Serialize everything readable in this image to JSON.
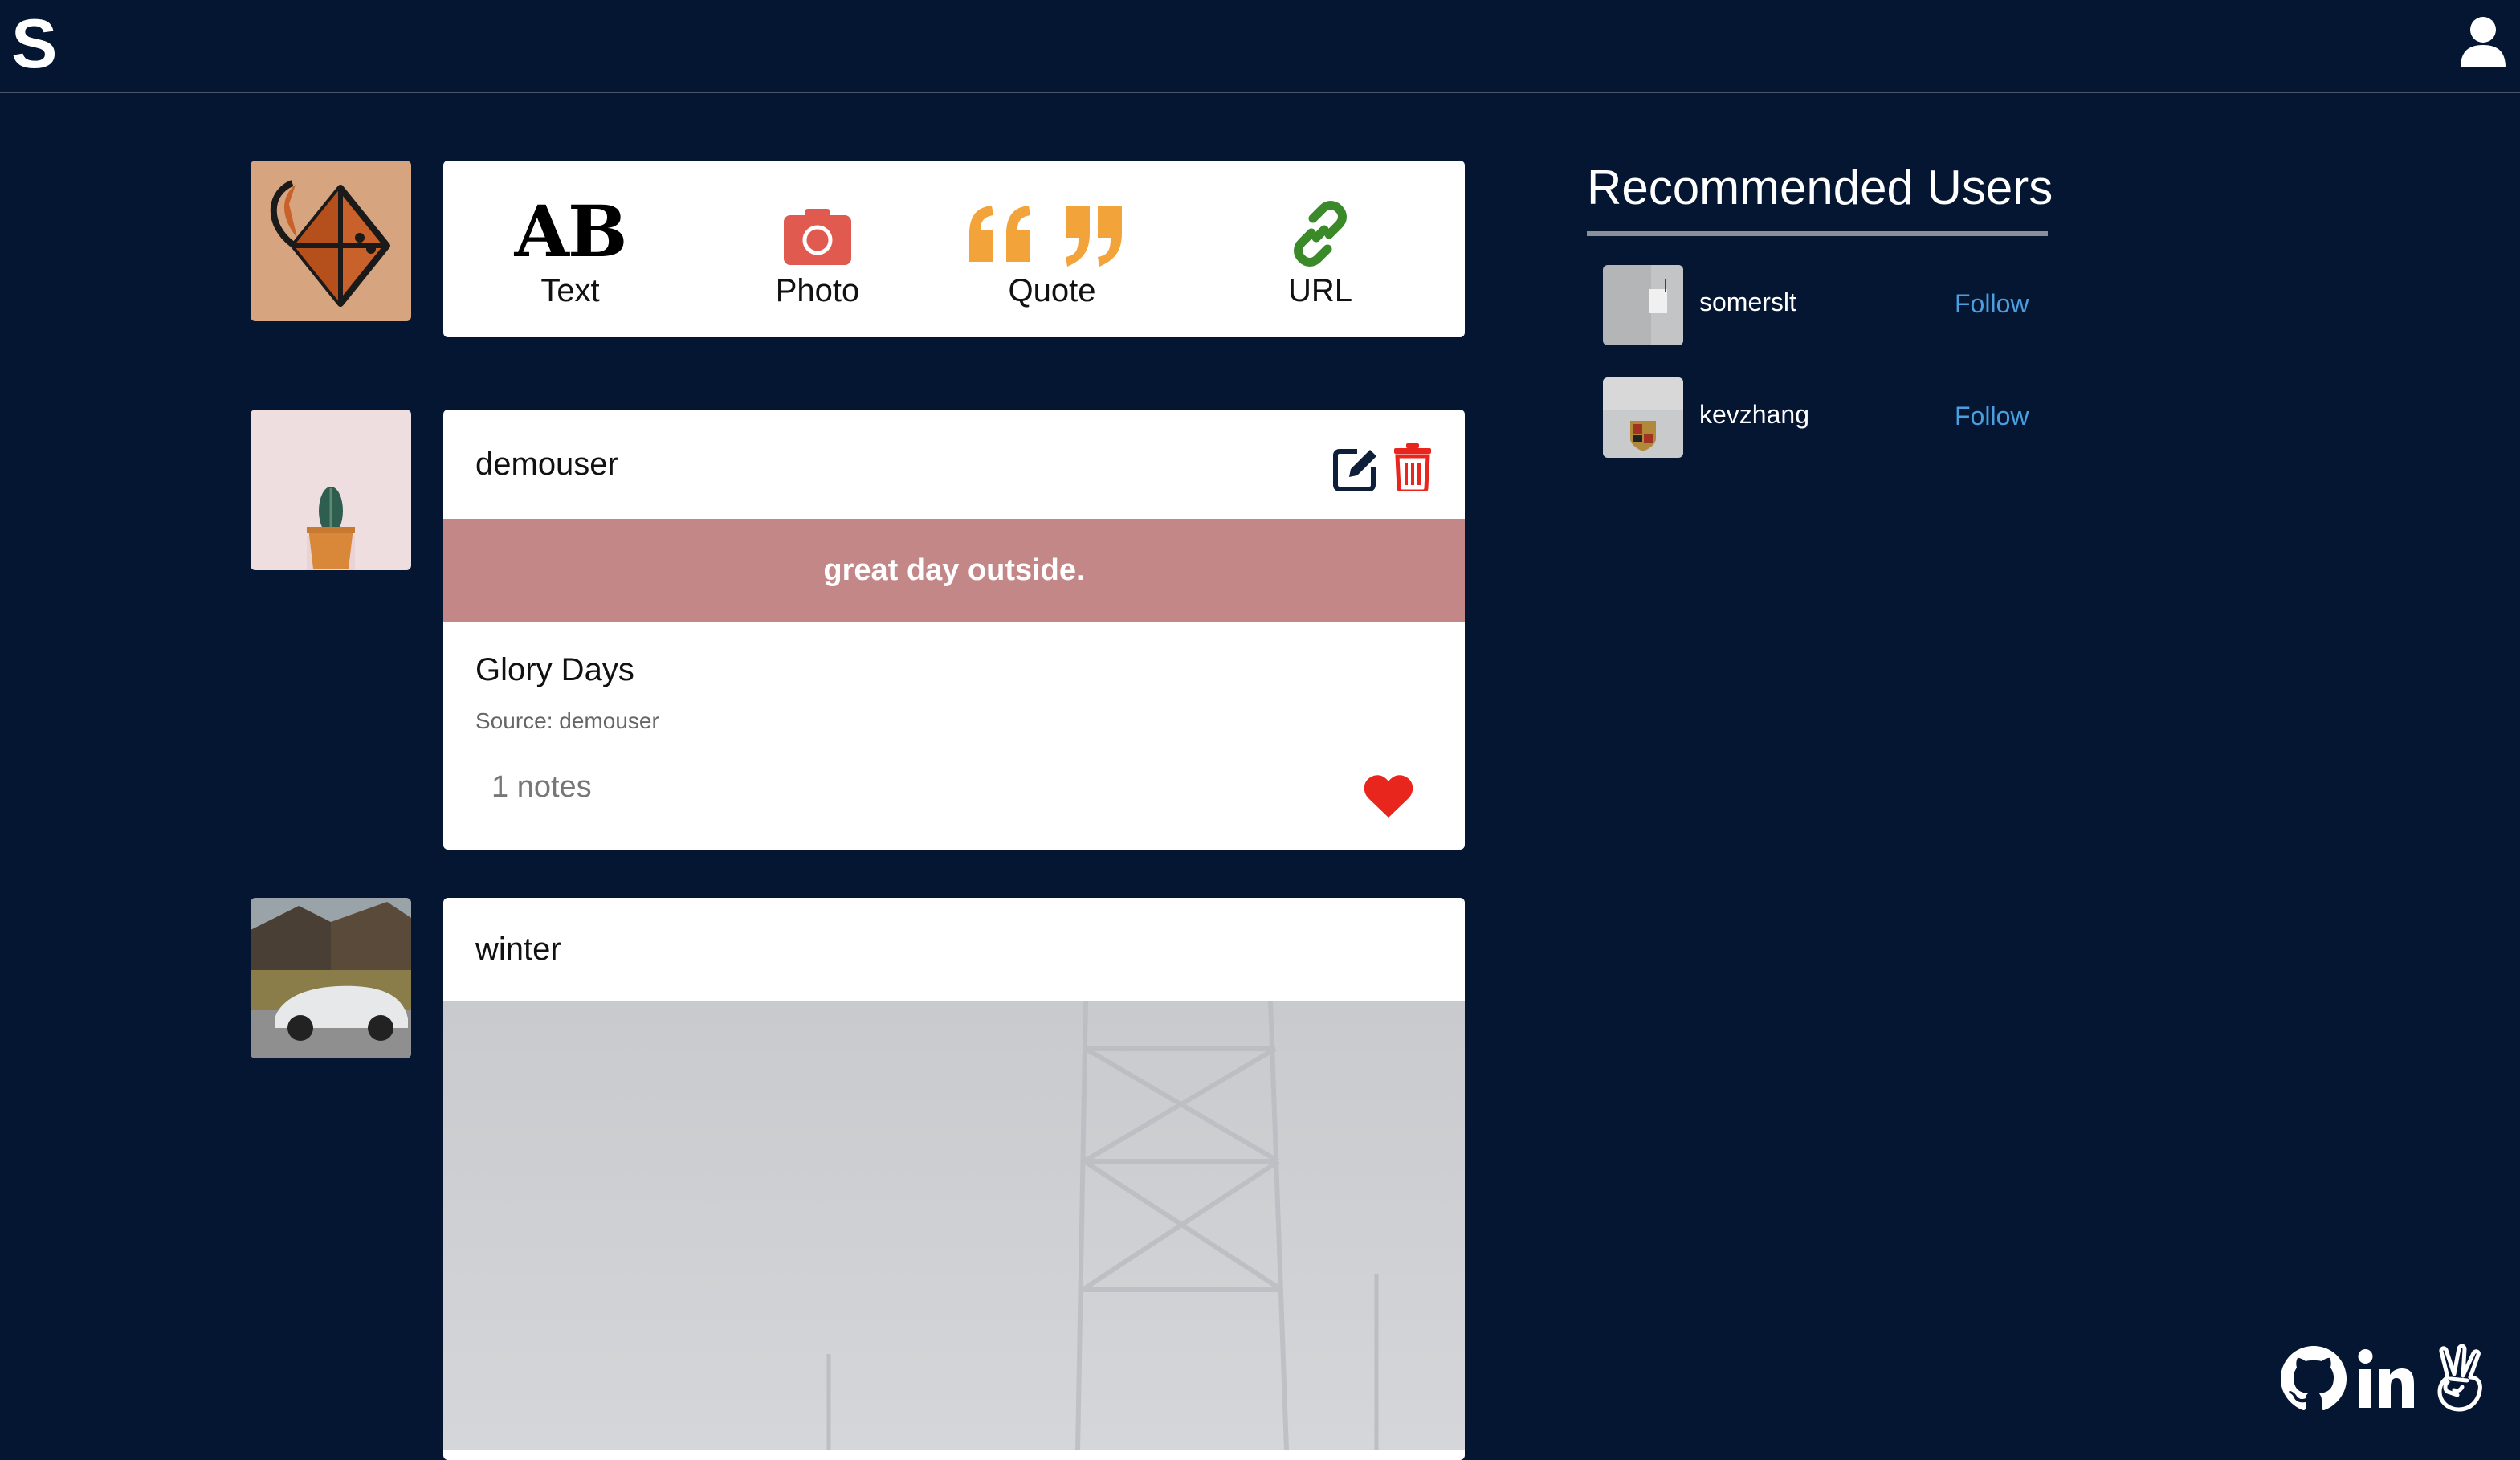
{
  "app": {
    "logo_letter": "S"
  },
  "post_types": [
    {
      "label": "Text",
      "glyph": "AB",
      "icon": "text-icon",
      "color": "#000000"
    },
    {
      "label": "Photo",
      "icon": "camera-icon",
      "color": "#e05a4f"
    },
    {
      "label": "Quote",
      "icon": "quote-icon",
      "color": "#f2a33a"
    },
    {
      "label": "URL",
      "icon": "link-icon",
      "color": "#3a8a2a"
    }
  ],
  "posts": [
    {
      "username": "demouser",
      "banner_text": "great day outside.",
      "title": "Glory Days",
      "source": "Source: demouser",
      "notes": "1 notes"
    },
    {
      "username": "winter"
    }
  ],
  "recommended": {
    "title": "Recommended Users",
    "users": [
      {
        "name": "somerslt",
        "follow_label": "Follow"
      },
      {
        "name": "kevzhang",
        "follow_label": "Follow"
      }
    ]
  },
  "colors": {
    "background": "#051633",
    "banner": "#c48787",
    "heart": "#e8261e",
    "trash": "#e8261e",
    "follow": "#4a9fe0",
    "camera": "#e05a4f",
    "quote": "#f2a33a",
    "link": "#3a8a2a"
  },
  "icons": {
    "user": "user-icon",
    "edit": "edit-icon",
    "trash": "trash-icon",
    "heart": "heart-icon",
    "social": [
      "github-icon",
      "linkedin-icon",
      "angellist-icon"
    ]
  }
}
